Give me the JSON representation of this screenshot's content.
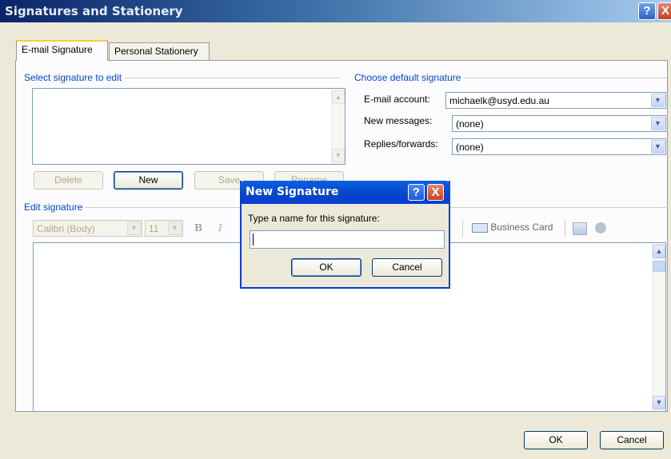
{
  "window": {
    "title": "Signatures and Stationery",
    "help_icon": "?",
    "close_icon": "X"
  },
  "tabs": [
    {
      "label": "E-mail Signature"
    },
    {
      "label": "Personal Stationery"
    }
  ],
  "select_signature": {
    "label": "Select signature to edit",
    "buttons": {
      "delete": "Delete",
      "new": "New",
      "save": "Save",
      "rename": "Rename"
    }
  },
  "default_signature": {
    "label": "Choose default signature",
    "email_account_label": "E-mail account:",
    "email_account_value": "michaelk@usyd.edu.au",
    "new_messages_label": "New messages:",
    "new_messages_value": "(none)",
    "replies_label": "Replies/forwards:",
    "replies_value": "(none)"
  },
  "edit_signature": {
    "label": "Edit signature",
    "font": "Calibri (Body)",
    "size": "11",
    "bold": "B",
    "italic": "I",
    "business_card": "Business Card"
  },
  "footer": {
    "ok": "OK",
    "cancel": "Cancel"
  },
  "new_signature_dialog": {
    "title": "New Signature",
    "help_icon": "?",
    "close_icon": "X",
    "prompt": "Type a name for this signature:",
    "input_value": "",
    "ok": "OK",
    "cancel": "Cancel"
  }
}
